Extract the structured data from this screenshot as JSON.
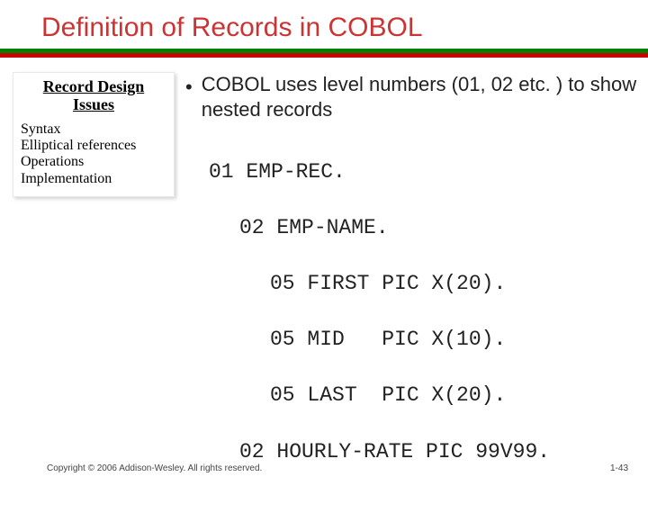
{
  "title": "Definition of Records in COBOL",
  "sidebar": {
    "heading_line1": "Record Design",
    "heading_line2": "Issues",
    "items": [
      "Syntax",
      "Elliptical references",
      "Operations",
      "Implementation"
    ]
  },
  "bullet": {
    "text": "COBOL uses level numbers (01, 02 etc. ) to show nested records"
  },
  "code": {
    "l1": "01 EMP-REC.",
    "l2": "02 EMP-NAME.",
    "l3": "05 FIRST PIC X(20).",
    "l4": "05 MID   PIC X(10).",
    "l5": "05 LAST  PIC X(20).",
    "l6": "02 HOURLY-RATE PIC 99V99."
  },
  "footer": {
    "copyright": "Copyright © 2006 Addison-Wesley. All rights reserved.",
    "page": "1-43"
  }
}
